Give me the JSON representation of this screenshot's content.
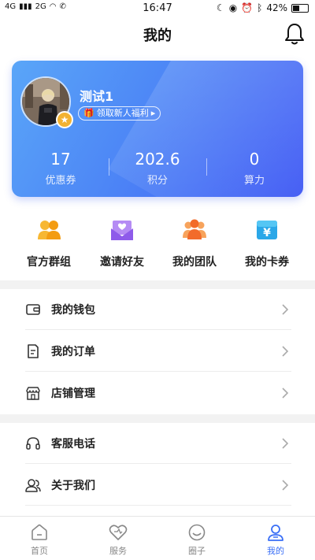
{
  "status_bar": {
    "signal1": "4G",
    "signal2": "2G",
    "time": "16:47",
    "battery": "42%"
  },
  "header": {
    "title": "我的"
  },
  "profile": {
    "username": "测试1",
    "newbie_label": "领取新人福利",
    "stats": [
      {
        "value": "17",
        "label": "优惠券"
      },
      {
        "value": "202.6",
        "label": "积分"
      },
      {
        "value": "0",
        "label": "算力"
      }
    ]
  },
  "quick_actions": [
    {
      "label": "官方群组",
      "icon": "group-icon"
    },
    {
      "label": "邀请好友",
      "icon": "invite-envelope-icon"
    },
    {
      "label": "我的团队",
      "icon": "team-icon"
    },
    {
      "label": "我的卡券",
      "icon": "coupon-icon"
    }
  ],
  "menu_group1": [
    {
      "label": "我的钱包",
      "icon": "wallet-icon"
    },
    {
      "label": "我的订单",
      "icon": "order-icon"
    },
    {
      "label": "店铺管理",
      "icon": "store-icon"
    }
  ],
  "menu_group2": [
    {
      "label": "客服电话",
      "icon": "headset-icon"
    },
    {
      "label": "关于我们",
      "icon": "users-icon"
    }
  ],
  "tabbar": [
    {
      "label": "首页",
      "icon": "home-icon"
    },
    {
      "label": "服务",
      "icon": "heart-icon"
    },
    {
      "label": "圈子",
      "icon": "smile-icon"
    },
    {
      "label": "我的",
      "icon": "person-icon",
      "active": true
    }
  ],
  "colors": {
    "accent": "#3a6ff6",
    "card_start": "#5aa6f8",
    "card_end": "#3f58f4"
  }
}
